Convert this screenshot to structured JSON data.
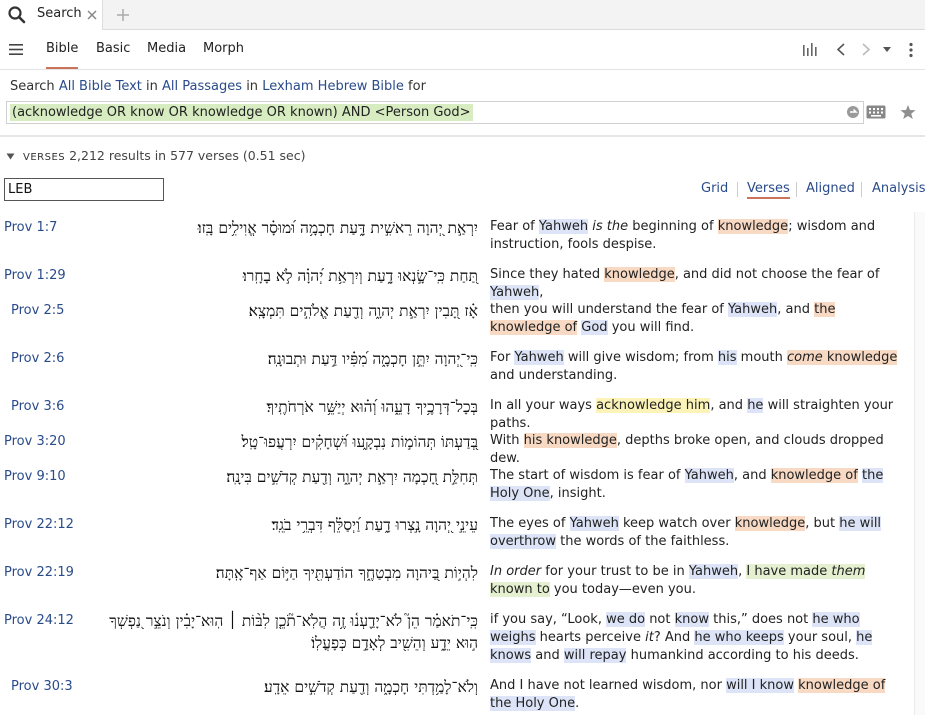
{
  "app": {
    "tab_title": "Search",
    "icons": {
      "search": "search-icon",
      "close": "close-icon",
      "add": "plus-icon",
      "menu": "hamburger-menu-icon",
      "chart": "bar-chart-icon",
      "back": "chevron-left-icon",
      "forward": "chevron-right-icon",
      "dropdown": "caret-down-icon",
      "more": "vertical-dots-icon",
      "refresh": "arrow-circle-icon",
      "keyboard": "keyboard-icon",
      "star": "star-icon",
      "collapse": "triangle-down-icon"
    }
  },
  "toolbar": {
    "tabs": [
      {
        "label": "Bible",
        "active": true
      },
      {
        "label": "Basic",
        "active": false
      },
      {
        "label": "Media",
        "active": false
      },
      {
        "label": "Morph",
        "active": false
      }
    ]
  },
  "search": {
    "prefix": "Search",
    "scope": "All Bible Text",
    "in1": "in",
    "range": "All Passages",
    "in2": "in",
    "version": "Lexham Hebrew Bible",
    "for": "for",
    "query": "(acknowledge OR know OR knowledge OR known) AND <Person God>"
  },
  "results": {
    "label": "VERSES",
    "summary": "2,212 results in 577 verses (0.51 sec)",
    "filter_value": "LEB",
    "views": [
      {
        "label": "Grid",
        "active": false
      },
      {
        "label": "Verses",
        "active": true
      },
      {
        "label": "Aligned",
        "active": false
      },
      {
        "label": "Analysis",
        "active": false
      }
    ]
  },
  "colors": {
    "highlight_blue": "#dde4f7",
    "highlight_orange": "#f8d9c3",
    "highlight_yellow": "#fbf3b8",
    "highlight_green": "#e5f0d0",
    "link": "#2a4b8a",
    "active_underline": "#c9745b"
  },
  "verses": [
    {
      "ref": "Prov 1:7",
      "hebrew": "יִרְאַ֣ת יְ֭הוָה רֵאשִׁ֣ית דָּ֑עַת חָכְמָ֥ה וּ֝מוּסָ֗ר אֱוִילִ֥ים בָּֽזוּ׃",
      "english": [
        {
          "t": "Fear of "
        },
        {
          "t": "Yahweh",
          "h": "blue"
        },
        {
          "t": " is the",
          "i": true
        },
        {
          "t": " beginning of "
        },
        {
          "t": "knowledge",
          "h": "orange"
        },
        {
          "t": "; wisdom and instruction, fools despise."
        }
      ]
    },
    {
      "ref": "Prov 1:29",
      "hebrew": "תַּ֭חַת כִּֽי־שָׂ֣נְאוּ דָ֑עַת וְיִרְאַ֥ת יְ֝הוָ֗ה לֹ֣א בָחָֽרוּ׃",
      "english": [
        {
          "t": "Since they hated "
        },
        {
          "t": "knowledge",
          "h": "orange"
        },
        {
          "t": ", and did not choose the fear of "
        },
        {
          "t": "Yahweh",
          "h": "blue"
        },
        {
          "t": ","
        }
      ]
    },
    {
      "ref": "Prov 2:5",
      "hebrew": "אָ֗ז תָּ֭בִין יִרְאַ֣ת יְהוָ֑ה וְדַ֖עַת אֱלֹהִ֣ים תִּמְצָֽא׃",
      "english": [
        {
          "t": "then you will understand the fear of "
        },
        {
          "t": "Yahweh",
          "h": "blue"
        },
        {
          "t": ", and "
        },
        {
          "t": "the knowledge of",
          "h": "orange"
        },
        {
          "t": " "
        },
        {
          "t": "God",
          "h": "blue"
        },
        {
          "t": " you will find."
        }
      ]
    },
    {
      "ref": "Prov 2:6",
      "hebrew": "כִּֽי־יְ֭הוָה יִתֵּ֣ן חָכְמָ֑ה מִ֝פִּ֗יו דַּ֣עַת וּתְבוּנָֽה׃",
      "english": [
        {
          "t": "For "
        },
        {
          "t": "Yahweh",
          "h": "blue"
        },
        {
          "t": " will give wisdom; from "
        },
        {
          "t": "his",
          "h": "blue"
        },
        {
          "t": " mouth "
        },
        {
          "t": "come",
          "h": "orange",
          "i": true
        },
        {
          "t": " knowledge",
          "h": "orange"
        },
        {
          "t": " and understanding."
        }
      ]
    },
    {
      "ref": "Prov 3:6",
      "hebrew": "בְּכָל־דְּרָכֶ֥יךָ דָעֵ֑הוּ וְ֝ה֗וּא יְיַשֵּׁ֥ר אֹרְחֹתֶֽיךָ׃",
      "english": [
        {
          "t": "In all your ways "
        },
        {
          "t": "acknowledge him",
          "h": "yellow"
        },
        {
          "t": ", and "
        },
        {
          "t": "he",
          "h": "blue"
        },
        {
          "t": " will straighten your paths."
        }
      ]
    },
    {
      "ref": "Prov 3:20",
      "hebrew": "בְּ֭דַעְתּוֹ תְּהוֹמ֣וֹת נִבְקָ֑עוּ וּ֝שְׁחָקִ֗ים יִרְעֲפוּ־טָֽל׃",
      "english": [
        {
          "t": "With "
        },
        {
          "t": "his knowledge",
          "h": "orange"
        },
        {
          "t": ", depths broke open, and clouds dropped dew."
        }
      ]
    },
    {
      "ref": "Prov 9:10",
      "hebrew": "תְּחִלַּ֣ת חָ֭כְמָה יִרְאַ֣ת יְהוָ֑ה וְדַ֖עַת קְדֹשִׁ֣ים בִּינָֽה׃",
      "english": [
        {
          "t": "The start of wisdom is fear of "
        },
        {
          "t": "Yahweh",
          "h": "blue"
        },
        {
          "t": ", and "
        },
        {
          "t": "knowledge of",
          "h": "orange"
        },
        {
          "t": " "
        },
        {
          "t": "the Holy One",
          "h": "blue"
        },
        {
          "t": ", insight."
        }
      ]
    },
    {
      "ref": "Prov 22:12",
      "hebrew": "עֵינֵ֣י יְ֭הוָה נָ֣צְרוּ דָ֑עַת וַ֝יְסַלֵּ֗ף דִּבְרֵ֥י בֹגֵֽד׃",
      "english": [
        {
          "t": "The eyes of "
        },
        {
          "t": "Yahweh",
          "h": "blue"
        },
        {
          "t": " keep watch over "
        },
        {
          "t": "knowledge",
          "h": "orange"
        },
        {
          "t": ", but "
        },
        {
          "t": "he will overthrow",
          "h": "blue"
        },
        {
          "t": " the words of the faithless."
        }
      ]
    },
    {
      "ref": "Prov 22:19",
      "hebrew": "לִהְי֣וֹת בַּ֭יהוָה מִבְטַחֶ֑ךָ הוֹדַעְתִּ֖יךָ הַיּ֣וֹם אַף־אָֽתָּה׃",
      "english": [
        {
          "t": "In order",
          "i": true
        },
        {
          "t": " for your trust to be in "
        },
        {
          "t": "Yahweh",
          "h": "blue"
        },
        {
          "t": ", "
        },
        {
          "t": "I have made ",
          "h": "green"
        },
        {
          "t": "them",
          "h": "green",
          "i": true
        },
        {
          "t": " known to",
          "h": "green"
        },
        {
          "t": " you today—even you."
        }
      ]
    },
    {
      "ref": "Prov 24:12",
      "hebrew": "כִּֽי־תֹאמַ֗ר הֵן֮ לֹא־יָדַ֪עְנ֫וּ זֶ֥ה הֲלֹֽא־תֹ֘כֵ֤ן לִבּ֨וֹת ׀ הֽוּא־יָבִ֗ין וְנֹצֵ֣ר נַ֭פְשְׁךָ",
      "hebrew2": "ה֣וּא יֵדָ֑ע וְהֵשִׁ֖יב לְאָדָ֣ם כְּפָעֳלֽוֹ׃",
      "english": [
        {
          "t": "if you say, “Look, "
        },
        {
          "t": "we do",
          "h": "blue"
        },
        {
          "t": " not "
        },
        {
          "t": "know",
          "h": "blue"
        },
        {
          "t": " this,” does not "
        },
        {
          "t": "he who weighs",
          "h": "blue"
        },
        {
          "t": " hearts perceive "
        },
        {
          "t": "it",
          "i": true
        },
        {
          "t": "? And "
        },
        {
          "t": "he who keeps",
          "h": "blue"
        },
        {
          "t": " your soul, "
        },
        {
          "t": "he knows",
          "h": "blue"
        },
        {
          "t": " and "
        },
        {
          "t": "will repay",
          "h": "blue"
        },
        {
          "t": " humankind according to his deeds."
        }
      ]
    },
    {
      "ref": "Prov 30:3",
      "hebrew": "וְלֹא־לָמַ֥דְתִּי חָכְמָ֑ה וְדַ֖עַת קְדֹשִׁ֣ים אֵדָֽע׃",
      "english": [
        {
          "t": "And I have not learned wisdom, nor "
        },
        {
          "t": "will I know",
          "h": "blue"
        },
        {
          "t": " "
        },
        {
          "t": "knowledge of",
          "h": "orange"
        },
        {
          "t": " "
        },
        {
          "t": "the Holy One",
          "h": "blue"
        },
        {
          "t": "."
        }
      ]
    }
  ]
}
